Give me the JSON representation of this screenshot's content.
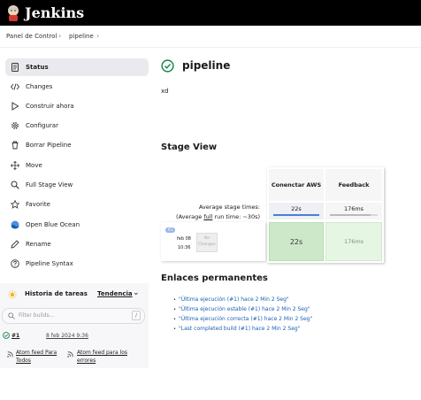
{
  "header": {
    "brand": "Jenkins"
  },
  "breadcrumb": [
    "Panel de Control",
    "pipeline"
  ],
  "sidebar": {
    "items": [
      {
        "label": "Status",
        "icon": "status-icon"
      },
      {
        "label": "Changes",
        "icon": "code-icon"
      },
      {
        "label": "Construir ahora",
        "icon": "play-icon"
      },
      {
        "label": "Configurar",
        "icon": "gear-icon"
      },
      {
        "label": "Borrar Pipeline",
        "icon": "trash-icon"
      },
      {
        "label": "Move",
        "icon": "move-icon"
      },
      {
        "label": "Full Stage View",
        "icon": "search-icon"
      },
      {
        "label": "Favorite",
        "icon": "star-icon"
      },
      {
        "label": "Open Blue Ocean",
        "icon": "blue-ocean-icon"
      },
      {
        "label": "Rename",
        "icon": "rename-icon"
      },
      {
        "label": "Pipeline Syntax",
        "icon": "help-icon"
      }
    ]
  },
  "build_history": {
    "title": "Historia de tareas",
    "trend": "Tendencia",
    "filter_placeholder": "Filter builds...",
    "filter_shortcut": "/",
    "build_number": "#1",
    "build_date": "8 feb 2024 9:36",
    "feed_all": "Atom feed Para Todos",
    "feed_errors": "Atom feed para los errores"
  },
  "main": {
    "title": "pipeline",
    "description": "xd",
    "stage_view_title": "Stage View",
    "stage_headers": [
      "Conenctar AWS",
      "Feedback"
    ],
    "avg_label_line1": "Average stage times:",
    "avg_label_line2_prefix": "(Average ",
    "avg_label_line2_link": "full",
    "avg_label_line2_suffix": " run time: ~30s)",
    "avg_times": [
      "22s",
      "176ms"
    ],
    "avg_progress": [
      1.0,
      0.85
    ],
    "run": {
      "badge": "#1",
      "date": "feb 08",
      "time": "10:36",
      "changes": "No Changes",
      "stage_times": [
        "22s",
        "176ms"
      ]
    },
    "permalinks_title": "Enlaces permanentes",
    "permalinks": [
      "\"Última ejecución (#1) hace 2 Min 2 Seg\"",
      "\"Última ejecución estable (#1) hace 2 Min 2 Seg\"",
      "\"Última ejecución correcta (#1) hace 2 Min 2 Seg\"",
      "\"Last completed build (#1) hace 2 Min 2 Seg\""
    ]
  },
  "colors": {
    "success": "#138347",
    "stage_green": "#e5f7e3",
    "link": "#1a5fb4"
  }
}
